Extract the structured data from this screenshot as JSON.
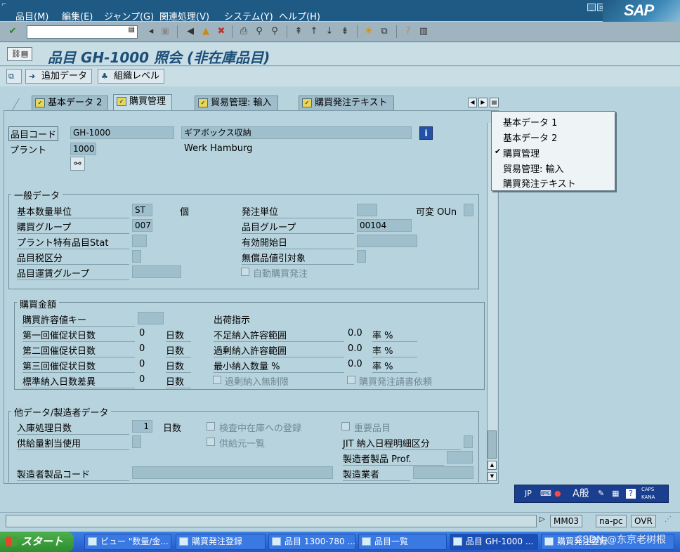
{
  "menu": [
    "品目(M)",
    "編集(E)",
    "ジャンプ(G)",
    "関連処理(V)",
    "システム(Y)",
    "ヘルプ(H)"
  ],
  "logo": "SAP",
  "title": "品目 GH-1000 照会 (非在庫品目)",
  "app_toolbar": {
    "add_data": "追加データ",
    "org_level": "組織レベル"
  },
  "tabs": [
    "基本データ 2",
    "購買管理",
    "貿易管理: 輸入",
    "購買発注テキスト"
  ],
  "dropdown": {
    "items": [
      "基本データ 1",
      "基本データ 2",
      "購買管理",
      "貿易管理: 輸入",
      "購買発注テキスト"
    ],
    "checked_index": 2
  },
  "header": {
    "material_label": "品目コード",
    "material_value": "GH-1000",
    "material_desc": "ギアボックス収納",
    "plant_label": "プラント",
    "plant_value": "1000",
    "plant_desc": "Werk Hamburg"
  },
  "general": {
    "title": "一般データ",
    "base_uom_label": "基本数量単位",
    "base_uom_value": "ST",
    "base_uom_text": "個",
    "order_unit_label": "発注単位",
    "var_label": "可変 OUn",
    "purch_group_label": "購買グループ",
    "purch_group_value": "007",
    "mat_group_label": "品目グループ",
    "mat_group_value": "00104",
    "plant_status_label": "プラント特有品目Stat",
    "valid_from_label": "有効開始日",
    "tax_label": "品目税区分",
    "discount_label": "無償品値引対象",
    "freight_label": "品目運賃グループ",
    "auto_po_label": "自動購買発注"
  },
  "purchasing": {
    "title": "購買金額",
    "tolerance_key_label": "購買許容値キー",
    "shipping_label": "出荷指示",
    "rows": [
      {
        "label": "第一回催促状日数",
        "value": "0",
        "unit": "日数",
        "label2": "不足納入許容範囲",
        "value2": "0.0",
        "unit2": "率 %"
      },
      {
        "label": "第二回催促状日数",
        "value": "0",
        "unit": "日数",
        "label2": "過剰納入許容範囲",
        "value2": "0.0",
        "unit2": "率 %"
      },
      {
        "label": "第三回催促状日数",
        "value": "0",
        "unit": "日数",
        "label2": "最小納入数量 %",
        "value2": "0.0",
        "unit2": "率 %"
      }
    ],
    "std_dev_label": "標準納入日数差異",
    "std_dev_value": "0",
    "std_dev_unit": "日数",
    "unlimited_label": "過剰納入無制限",
    "ack_label": "購買発注請書依頼"
  },
  "other": {
    "title": "他データ/製造者データ",
    "gr_days_label": "入庫処理日数",
    "gr_days_value": "1",
    "gr_days_unit": "日数",
    "qi_label": "検査中在庫への登録",
    "critical_label": "重要品目",
    "quota_label": "供給量割当使用",
    "source_label": "供給元一覧",
    "jit_label": "JIT 納入日程明細区分",
    "mpn_prof_label": "製造者製品 Prof.",
    "mpn_label": "製造者製品コード",
    "mfr_label": "製造業者"
  },
  "ime": {
    "lang": "JP",
    "mode": "A般",
    "caps": "CAPS",
    "kana": "KANA"
  },
  "status": {
    "tcode": "MM03",
    "server": "na-pc",
    "mode": "OVR"
  },
  "taskbar": {
    "start": "スタート",
    "tasks": [
      "ビュー \"数量/金...",
      "購買発注登録",
      "品目 1300-780 ...",
      "品目一覧",
      "品目 GH-1000 ...",
      "購買発注登録"
    ],
    "watermark": "CSDN @东京老树根"
  }
}
